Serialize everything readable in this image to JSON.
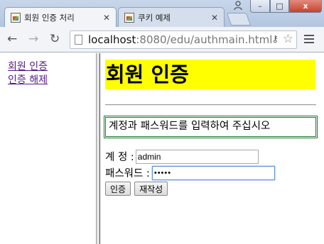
{
  "tabs": [
    {
      "title": "회원 인증 처리",
      "active": true
    },
    {
      "title": "쿠키 예제",
      "active": false
    }
  ],
  "window": {
    "close_glyph": "x",
    "max_glyph": "□",
    "min_glyph": "–"
  },
  "toolbar": {
    "url_host": "localhost",
    "url_path": ":8080/edu/authmain.html"
  },
  "left_frame": {
    "links": [
      {
        "label": "회원 인증"
      },
      {
        "label": "인증 해제"
      }
    ]
  },
  "main": {
    "heading": "회원 인증",
    "notice": "계정과 패스워드를 입력하여 주십시오",
    "account_label": "계 정 :",
    "account_value": "admin",
    "password_label": "패스워드 :",
    "password_value": "•••••",
    "submit_label": "인증",
    "reset_label": "재작성"
  },
  "colors": {
    "heading_background": "#ffff00",
    "notice_border": "#1f7a2e",
    "link_visited": "#551a8b"
  }
}
